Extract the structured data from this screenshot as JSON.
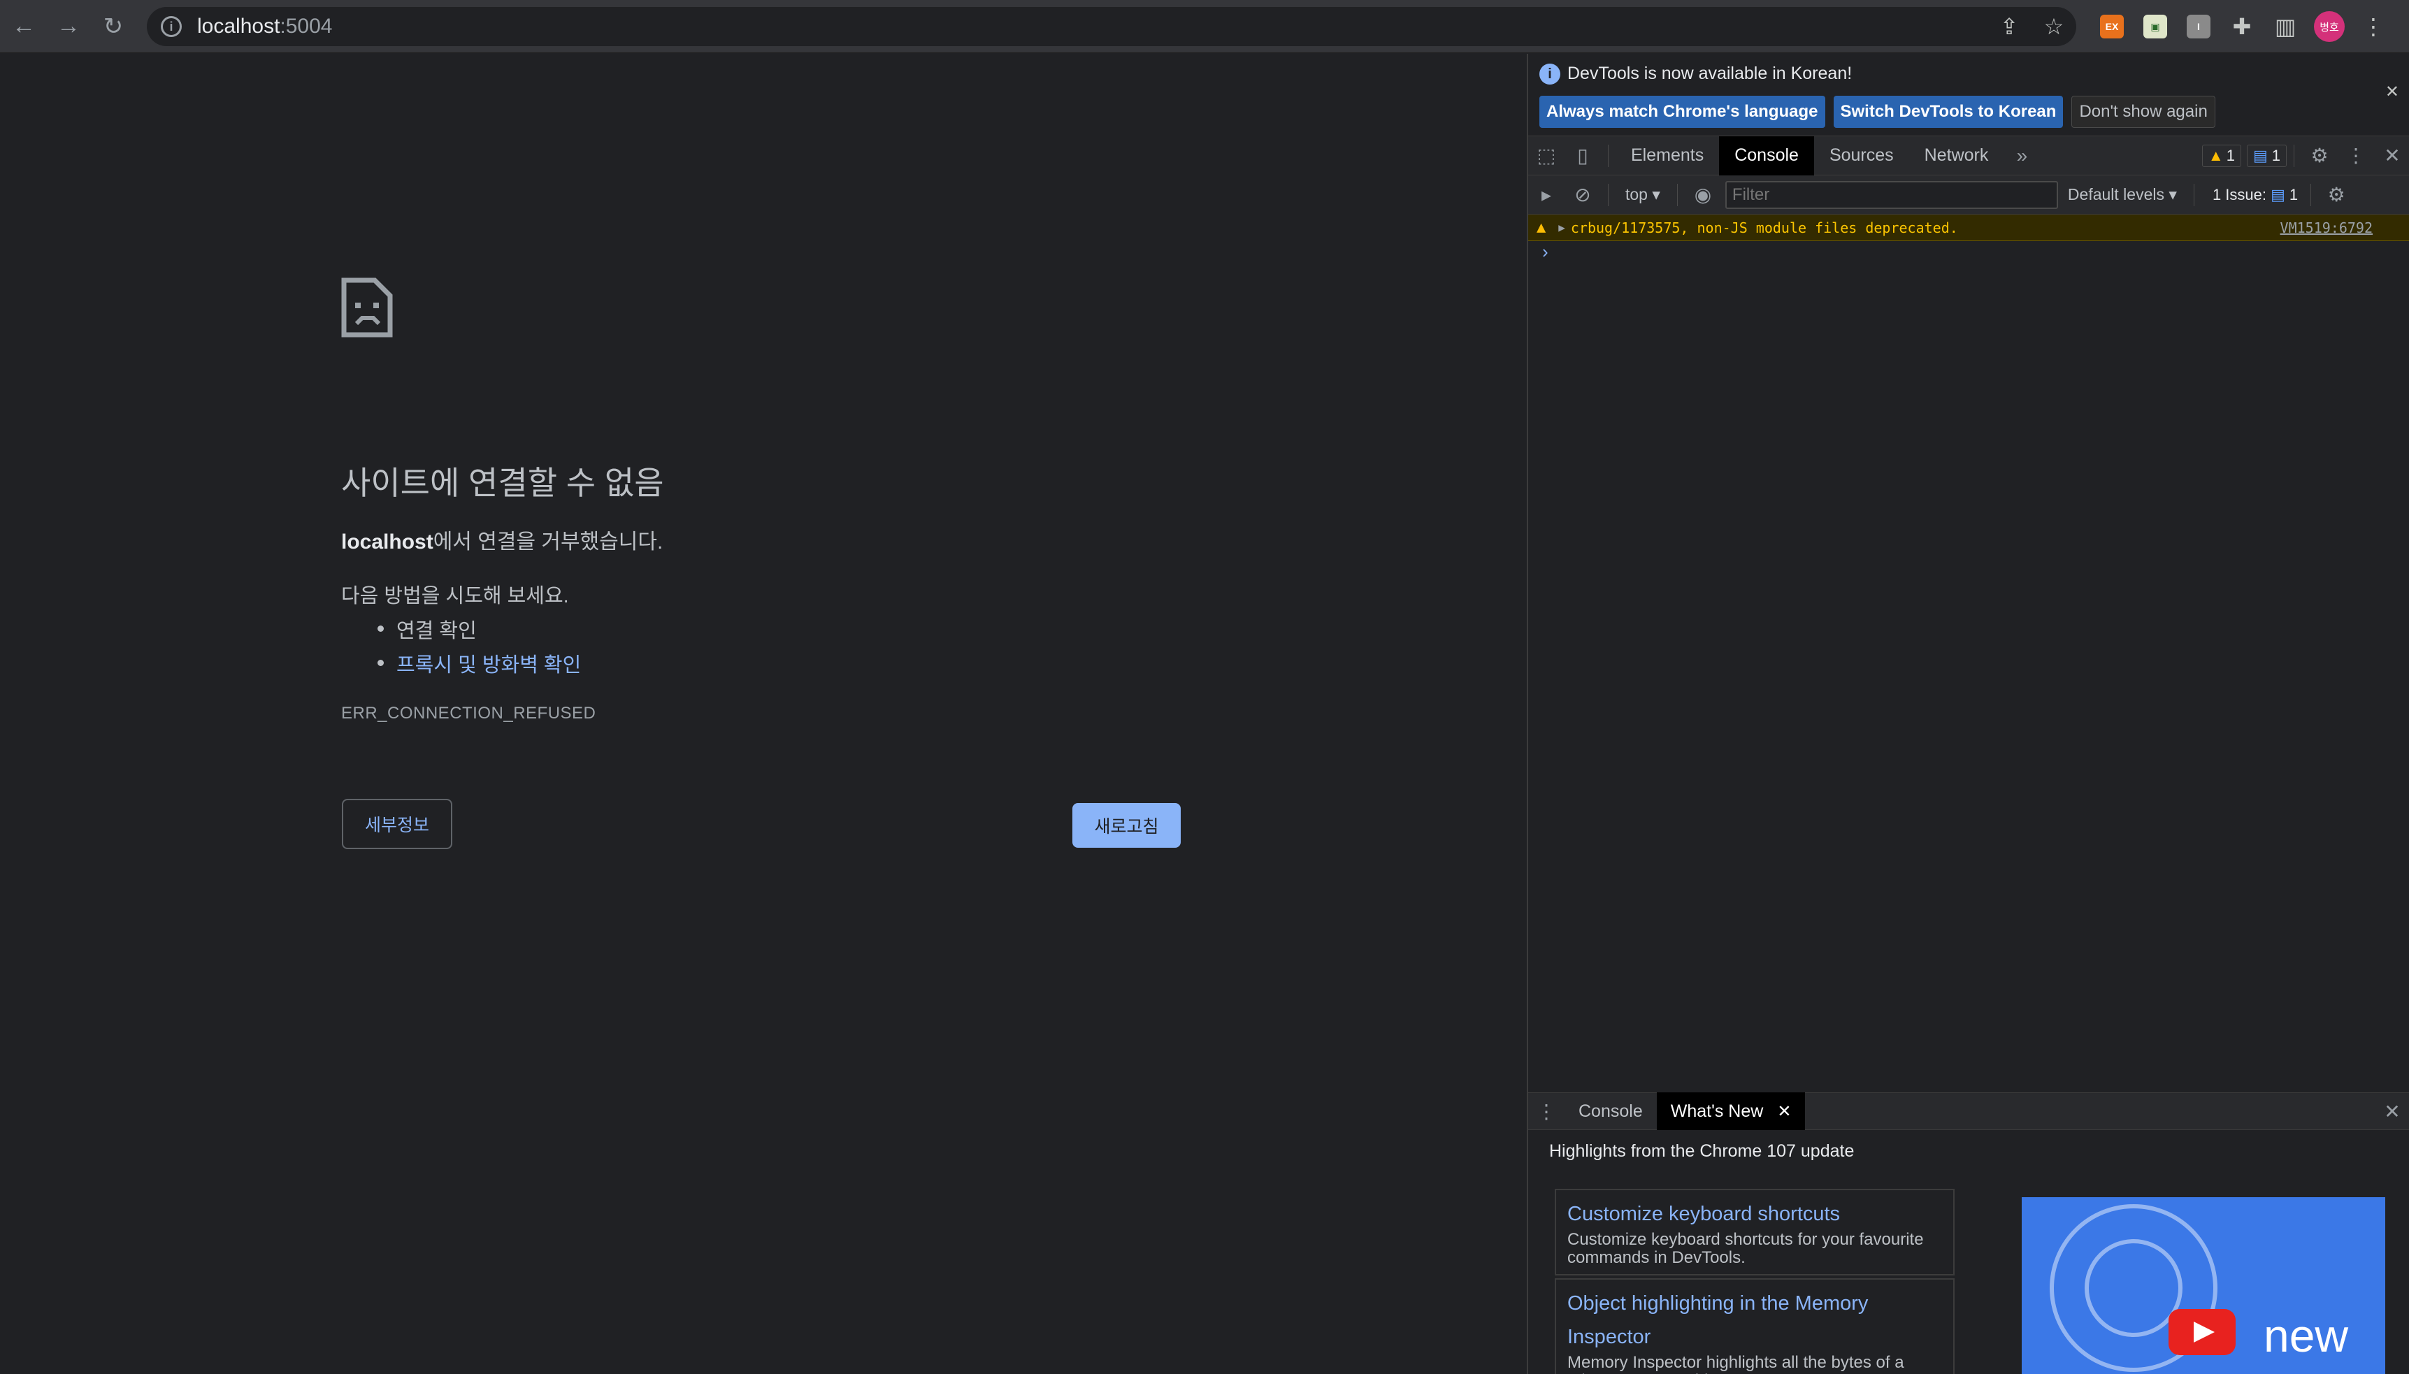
{
  "browser": {
    "url_host": "localhost",
    "url_port": ":5004",
    "avatar_text": "병호",
    "extension_1": "EX"
  },
  "error_page": {
    "title": "사이트에 연결할 수 없음",
    "desc_host": "localhost",
    "desc_rest": "에서 연결을 거부했습니다.",
    "try_label": "다음 방법을 시도해 보세요.",
    "tips": [
      "연결 확인",
      "프록시 및 방화벽 확인"
    ],
    "error_code": "ERR_CONNECTION_REFUSED",
    "details_button": "세부정보",
    "reload_button": "새로고침"
  },
  "devtools": {
    "banner_message": "DevTools is now available in Korean!",
    "banner_buttons": [
      "Always match Chrome's language",
      "Switch DevTools to Korean",
      "Don't show again"
    ],
    "tabs": [
      "Elements",
      "Console",
      "Sources",
      "Network"
    ],
    "active_tab": "Console",
    "warn_count": "1",
    "msg_count": "1",
    "context": "top",
    "filter_placeholder": "Filter",
    "levels": "Default levels",
    "issues_label": "1 Issue:",
    "issues_count": "1",
    "console_message": "crbug/1173575, non-JS module files deprecated.",
    "console_source": "VM1519:6792",
    "drawer_tabs": [
      "Console",
      "What's New"
    ],
    "whats_new_heading": "Highlights from the Chrome 107 update",
    "cards": [
      {
        "title": "Customize keyboard shortcuts",
        "desc": "Customize keyboard shortcuts for your favourite commands in DevTools."
      },
      {
        "title": "Object highlighting in the Memory Inspector",
        "desc": "Memory Inspector highlights all the bytes of a C/C++ memory object."
      }
    ],
    "thumbnail_text": "new"
  },
  "colors": {
    "accent": "#8ab4f8",
    "page_bg": "#202124",
    "warning": "#fbbc04"
  }
}
